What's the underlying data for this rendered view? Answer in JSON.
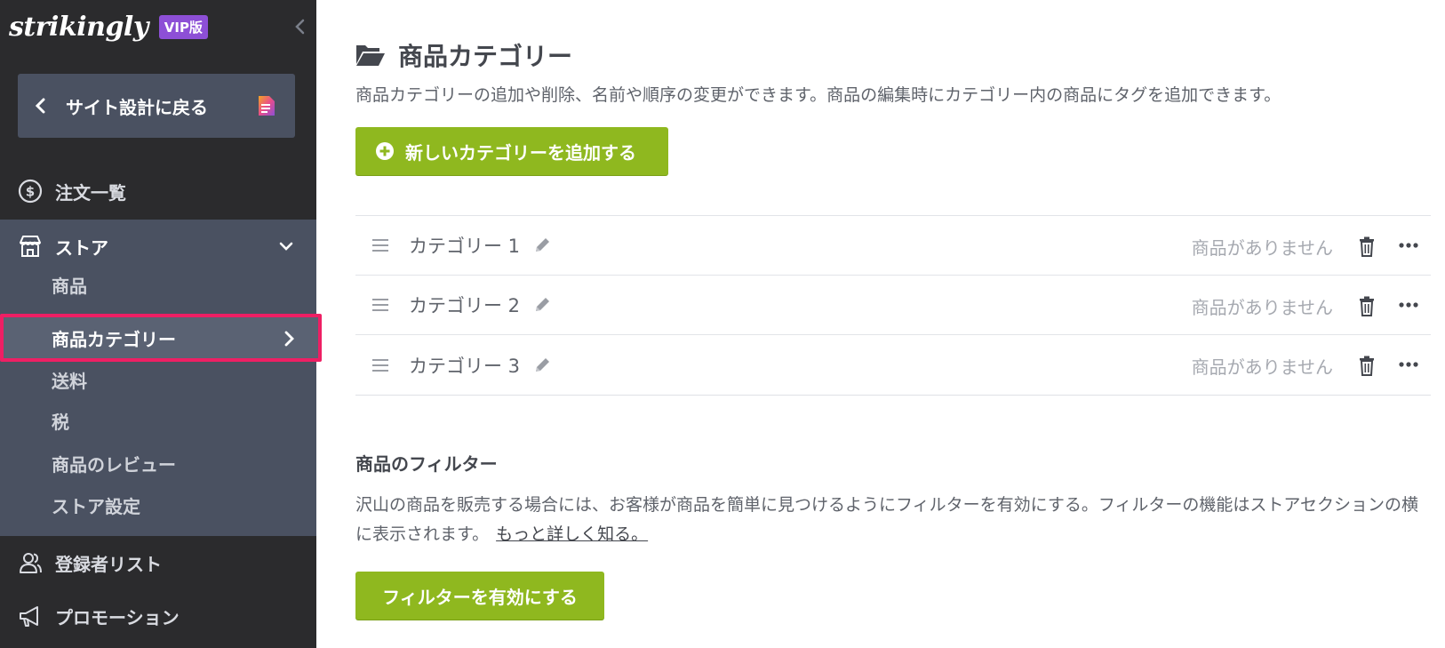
{
  "sidebar": {
    "logo": "strikingly",
    "badge": "VIP版",
    "back_label": "サイト設計に戻る",
    "nav_orders": "注文一覧",
    "store": {
      "label": "ストア",
      "items": [
        {
          "label": "商品"
        },
        {
          "label": "商品カテゴリー"
        },
        {
          "label": "送料"
        },
        {
          "label": "税"
        },
        {
          "label": "商品のレビュー"
        },
        {
          "label": "ストア設定"
        }
      ]
    },
    "nav_subscribers": "登録者リスト",
    "nav_promotion": "プロモーション"
  },
  "main": {
    "title": "商品カテゴリー",
    "description": "商品カテゴリーの追加や削除、名前や順序の変更ができます。商品の編集時にカテゴリー内の商品にタグを追加できます。",
    "add_button": "新しいカテゴリーを追加する",
    "categories": [
      {
        "name": "カテゴリー 1",
        "status": "商品がありません"
      },
      {
        "name": "カテゴリー 2",
        "status": "商品がありません"
      },
      {
        "name": "カテゴリー 3",
        "status": "商品がありません"
      }
    ],
    "filter": {
      "title": "商品のフィルター",
      "description": "沢山の商品を販売する場合には、お客様が商品を簡単に見つけるようにフィルターを有効にする。フィルターの機能はストアセクションの横に表示されます。",
      "learn_more": "もっと詳しく知る。",
      "button": "フィルターを有効にする"
    }
  },
  "colors": {
    "sidebar_bg": "#2b2b2d",
    "panel_bg": "#4a5161",
    "accent_green": "#8fb81f",
    "highlight_pink": "#ee1f64",
    "vip_purple": "#8d4fd6"
  }
}
